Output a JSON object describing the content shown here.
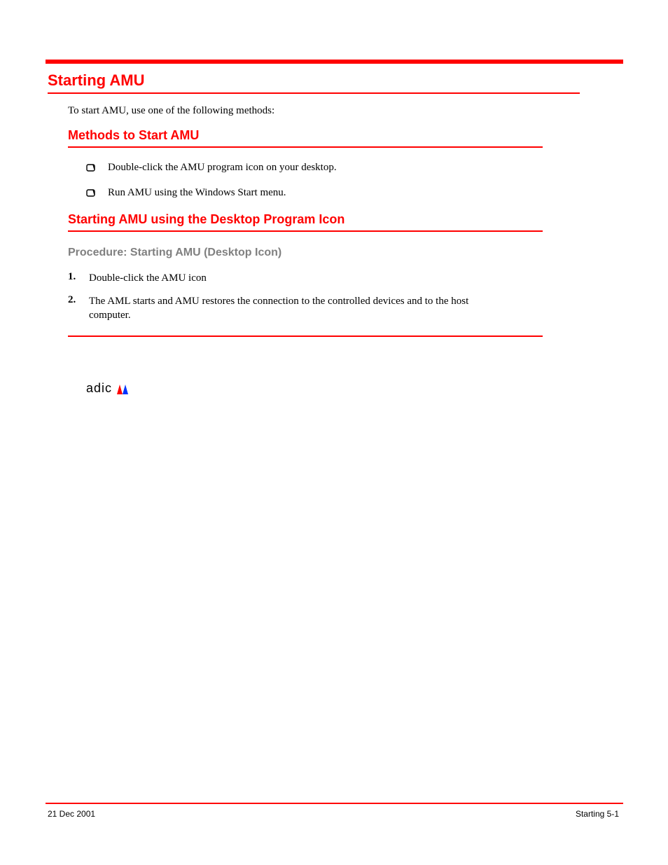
{
  "header": {
    "title": "Starting AMU"
  },
  "intro": "To start AMU, use one of the following methods:",
  "section1": {
    "title": "Methods to Start AMU",
    "items": [
      "Double-click the AMU program icon on your desktop.",
      "Run AMU using the Windows Start menu."
    ]
  },
  "section2": {
    "title": "Starting AMU using the Desktop Program Icon",
    "procedure_title": "Procedure: Starting AMU (Desktop Icon)",
    "steps": [
      "Double-click the AMU icon",
      "The AML starts and AMU restores the connection to the controlled devices and to the host computer."
    ]
  },
  "logo": "adic",
  "footer": {
    "left": "21 Dec 2001",
    "right": "Starting 5-1"
  }
}
